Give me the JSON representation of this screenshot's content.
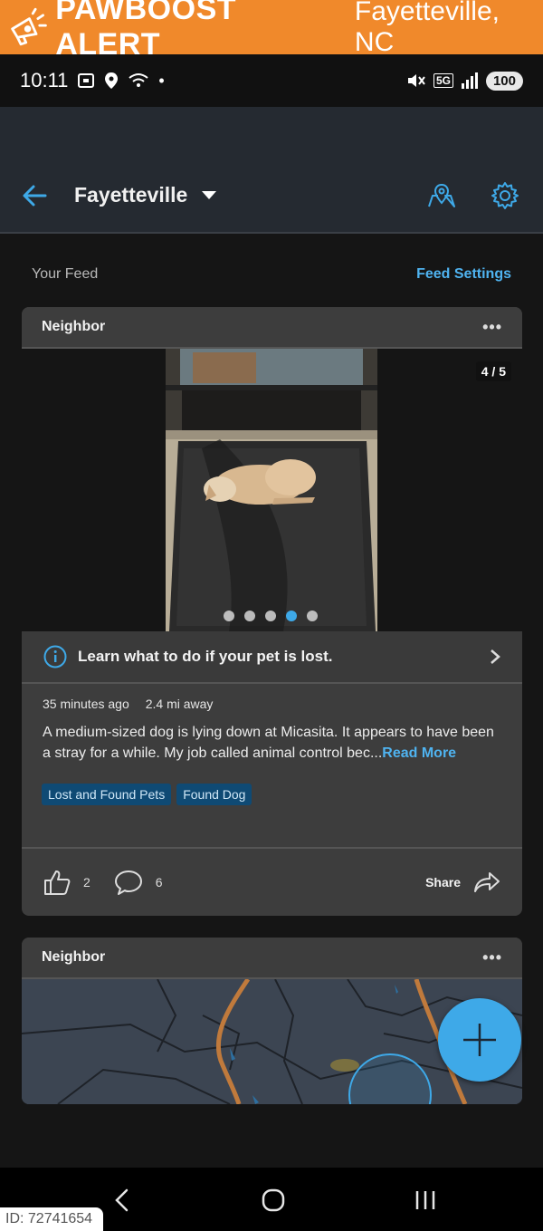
{
  "banner": {
    "title": "PAWBOOST ALERT",
    "city": "Fayetteville, NC",
    "color": "#f0892b"
  },
  "status": {
    "time": "10:11",
    "network": "5G",
    "battery": "100"
  },
  "header": {
    "location": "Fayetteville"
  },
  "feed": {
    "label": "Your Feed",
    "settings_label": "Feed Settings"
  },
  "post": {
    "author": "Neighbor",
    "more": "•••",
    "photo_counter": "4 / 5",
    "photo_count": 5,
    "active_photo": 4,
    "learn_text": "Learn what to do if your pet is lost.",
    "time_ago": "35 minutes ago",
    "distance": "2.4 mi away",
    "text": "A medium-sized dog is lying down at Micasita. It appears to have been a stray for a while. My job called animal control bec...",
    "read_more": "Read More",
    "tags": [
      "Lost and Found Pets",
      "Found Dog"
    ],
    "likes": "2",
    "comments": "6",
    "share_label": "Share"
  },
  "post2": {
    "author": "Neighbor",
    "more": "•••"
  },
  "id_badge": "ID: 72741654",
  "colors": {
    "accent": "#3ea9e8",
    "card": "#3d3d3d",
    "background": "#151515"
  }
}
